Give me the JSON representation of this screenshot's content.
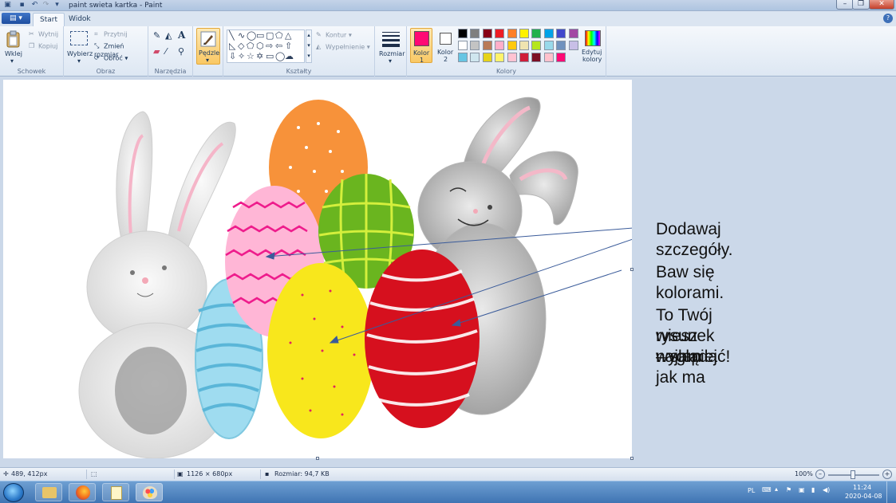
{
  "titlebar": {
    "title": "paint swieta kartka - Paint"
  },
  "tabs": {
    "file": "",
    "start": "Start",
    "view": "Widok"
  },
  "ribbon": {
    "clipboard": {
      "paste": "Wklej",
      "cut": "Wytnij",
      "copy": "Kopiuj",
      "label": "Schowek"
    },
    "image": {
      "select": "Wybierz",
      "crop": "Przytnij",
      "resize": "Zmień rozmiar",
      "rotate": "Obróć",
      "label": "Obraz"
    },
    "tools": {
      "label": "Narzędzia"
    },
    "brushes": {
      "label": "Pędzle"
    },
    "shapes": {
      "outline": "Kontur",
      "fill": "Wypełnienie",
      "label": "Kształty"
    },
    "size": {
      "label": "Rozmiar"
    },
    "colors": {
      "color1": "Kolor",
      "color1_n": "1",
      "color2": "Kolor",
      "color2_n": "2",
      "edit": "Edytuj",
      "edit2": "kolory",
      "label": "Kolory"
    }
  },
  "palette": {
    "row1": [
      "#000000",
      "#7f7f7f",
      "#880015",
      "#ed1c24",
      "#ff7f27",
      "#fff200",
      "#22b14c",
      "#00a2e8",
      "#3f48cc",
      "#a349a4"
    ],
    "row2": [
      "#ffffff",
      "#c3c3c3",
      "#b97a57",
      "#ffaec9",
      "#ffc90e",
      "#efe4b0",
      "#b5e61d",
      "#99d9ea",
      "#7092be",
      "#c8bfe7"
    ],
    "row3": [
      "#67c5e3",
      "#cfe6ef",
      "#e6d31a",
      "#fff36b",
      "#ffc3d2",
      "#cf1e3a",
      "#7d0f24",
      "#ffc1cc",
      "#ff0a74"
    ],
    "color1": "#ff0a74",
    "color2": "#ffffff"
  },
  "canvas": {
    "notes": [
      "Dodawaj szczegóły.",
      "Baw się kolorami.",
      "To Twój rysunek – sam",
      "wiesz najlepiej jak ma",
      "wyglądać!"
    ],
    "egg_colors": {
      "orange": "#f7923a",
      "pink": "#ffb6d6",
      "green": "#6ab51f",
      "blue": "#9fdcf0",
      "yellow": "#f8e71c",
      "red": "#d6101e"
    },
    "arrow_color": "#3a5b9a"
  },
  "status": {
    "cursor": "489, 412px",
    "dimensions": "1126 × 680px",
    "filesize": "Rozmiar: 94,7 KB",
    "zoom": "100%"
  },
  "taskbar": {
    "lang": "PL",
    "time": "11:24",
    "date": "2020-04-08"
  }
}
